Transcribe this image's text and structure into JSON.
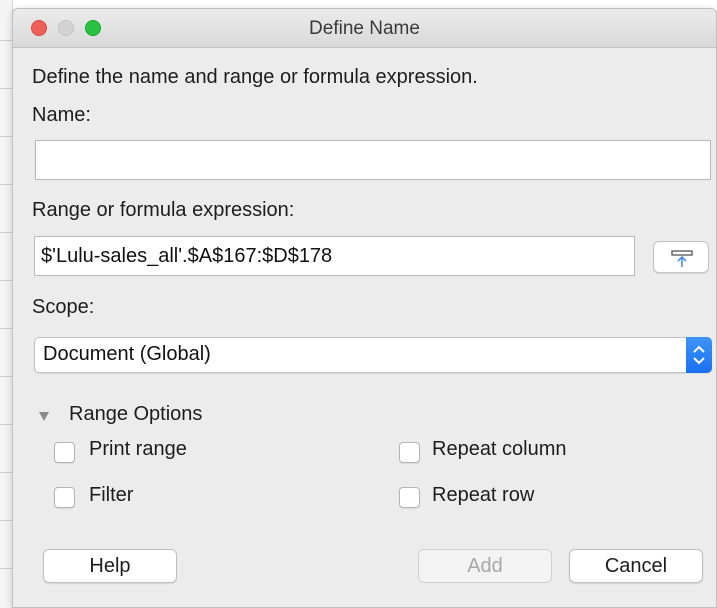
{
  "window": {
    "title": "Define Name"
  },
  "intro_text": "Define the name and range or formula expression.",
  "name": {
    "label": "Name:",
    "value": ""
  },
  "range": {
    "label": "Range or formula expression:",
    "value": "$'Lulu-sales_all'.$A$167:$D$178"
  },
  "scope": {
    "label": "Scope:",
    "selected": "Document (Global)"
  },
  "range_options": {
    "label": "Range Options",
    "print_range": "Print range",
    "filter": "Filter",
    "repeat_column": "Repeat column",
    "repeat_row": "Repeat row"
  },
  "buttons": {
    "help": "Help",
    "add": "Add",
    "cancel": "Cancel"
  },
  "colors": {
    "accent": "#1f76f2",
    "close": "#ee5f57",
    "maximize": "#29c244"
  }
}
